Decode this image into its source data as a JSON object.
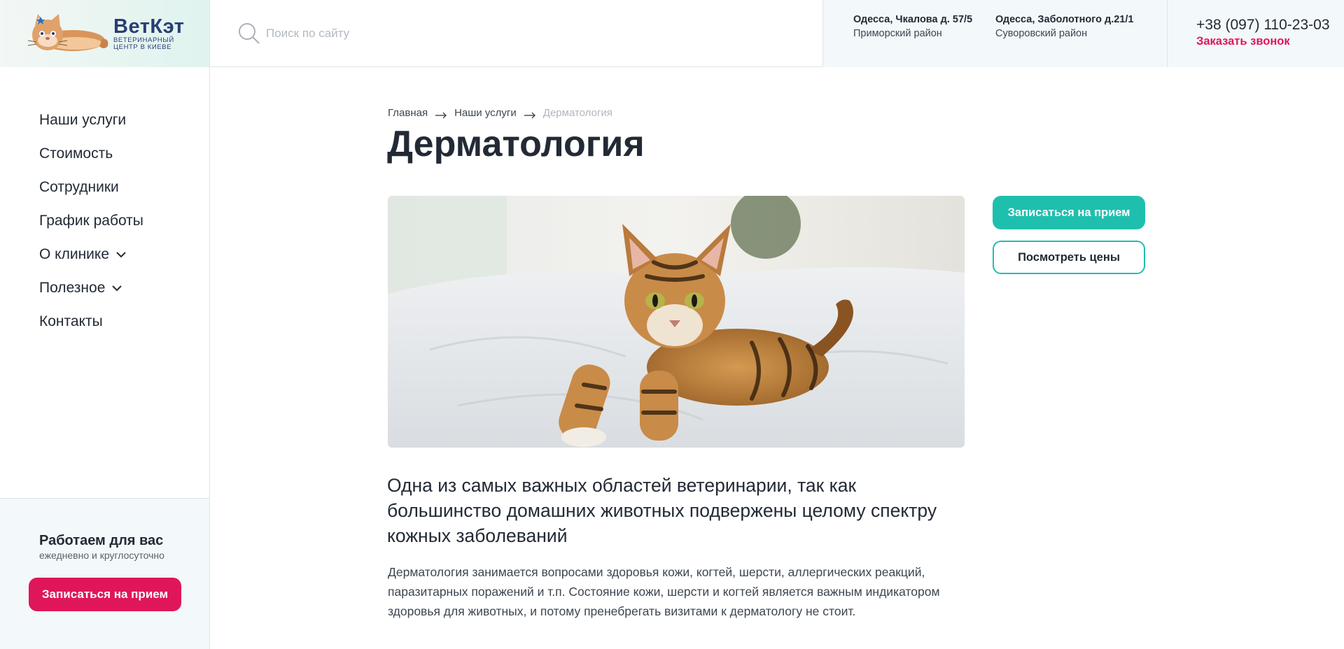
{
  "header": {
    "logo": {
      "name": "ВетКэт",
      "subtitle_line1": "ВЕТЕРИНАРНЫЙ",
      "subtitle_line2": "ЦЕНТР В КИЕВЕ",
      "icon": "cat-logo-icon"
    },
    "search": {
      "placeholder": "Поиск по сайту",
      "value": "",
      "icon": "search-icon"
    },
    "addresses": [
      {
        "street": "Одесса, Чкалова д. 57/5",
        "district": "Приморский район"
      },
      {
        "street": "Одесса, Заболотного д.21/1",
        "district": "Суворовский район"
      }
    ],
    "phone": "+38 (097) 110-23-03",
    "callback_label": "Заказать звонок"
  },
  "sidebar": {
    "items": [
      {
        "label": "Наши услуги"
      },
      {
        "label": "Стоимость"
      },
      {
        "label": "Сотрудники"
      },
      {
        "label": "График работы"
      },
      {
        "label": "О клинике",
        "icon": "chevron-down-icon"
      },
      {
        "label": "Полезное",
        "icon": "chevron-down-icon"
      },
      {
        "label": "Контакты"
      }
    ],
    "work": {
      "title": "Работаем для вас",
      "subtitle": "ежедневно и круглосуточно",
      "button_label": "Записаться на прием"
    }
  },
  "main": {
    "breadcrumb": [
      "Главная",
      "Наши услуги",
      "Дерматология"
    ],
    "title": "Дерматология",
    "hero_image": "bengal-cat-on-bed-photo",
    "actions": {
      "primary_label": "Записаться на прием",
      "secondary_label": "Посмотреть цены"
    },
    "lead": "Одна из самых важных областей ветеринарии, так как большинство домашних животных подвержены целому спектру кожных заболеваний",
    "body": "Дерматология занимается вопросами здоровья кожи, когтей, шерсти, аллергических реакций, паразитарных поражений и т.п. Состояние кожи, шерсти и когтей является важным индикатором здоровья для животных, и потому пренебрегать визитами к дерматологу не стоит."
  },
  "colors": {
    "accent_red": "#e0165a",
    "accent_teal": "#1fbfae",
    "brand_navy": "#2a3d73",
    "panel_bg": "#f3f8fa"
  }
}
